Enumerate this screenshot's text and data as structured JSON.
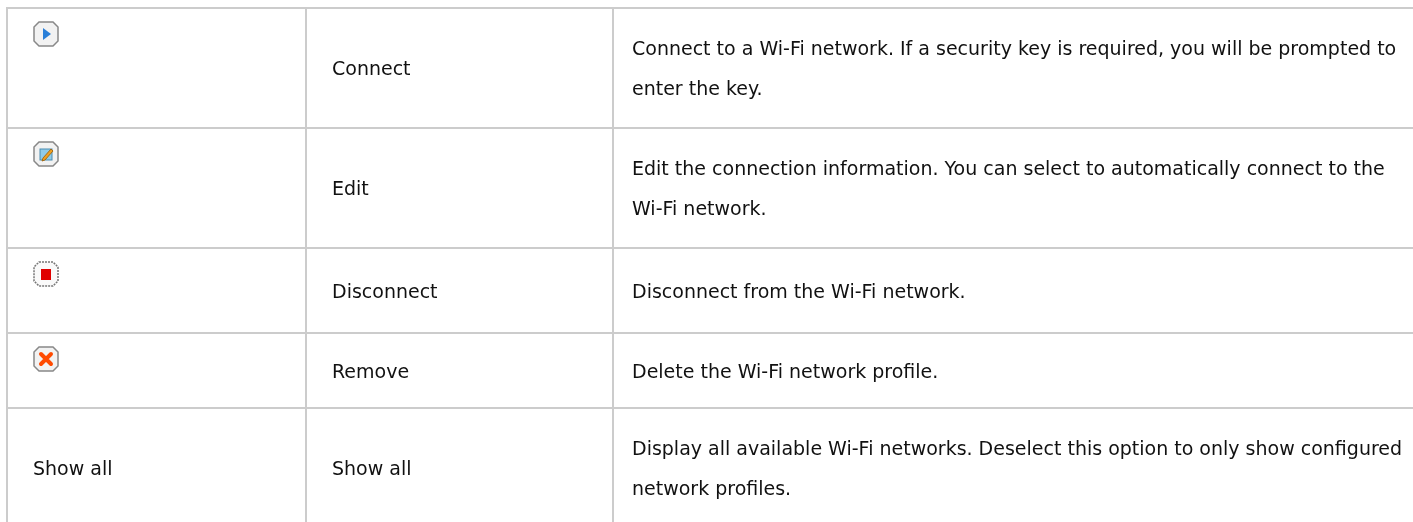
{
  "table": {
    "rows": [
      {
        "kind": "play",
        "name": "Connect",
        "description": "Connect to a Wi-Fi network. If a security key is required, you will be prompted to enter the key."
      },
      {
        "kind": "edit",
        "name": "Edit",
        "description": "Edit the connection information. You can select to automatically connect to the Wi-Fi network."
      },
      {
        "kind": "stop",
        "name": "Disconnect",
        "description": "Disconnect from the Wi-Fi network."
      },
      {
        "kind": "remove",
        "name": "Remove",
        "description": "Delete the Wi-Fi network profile."
      },
      {
        "kind": "text",
        "label": "Show all",
        "name": "Show all",
        "description": "Display all available Wi-Fi networks. Deselect this option to only show configured network profiles."
      }
    ]
  }
}
